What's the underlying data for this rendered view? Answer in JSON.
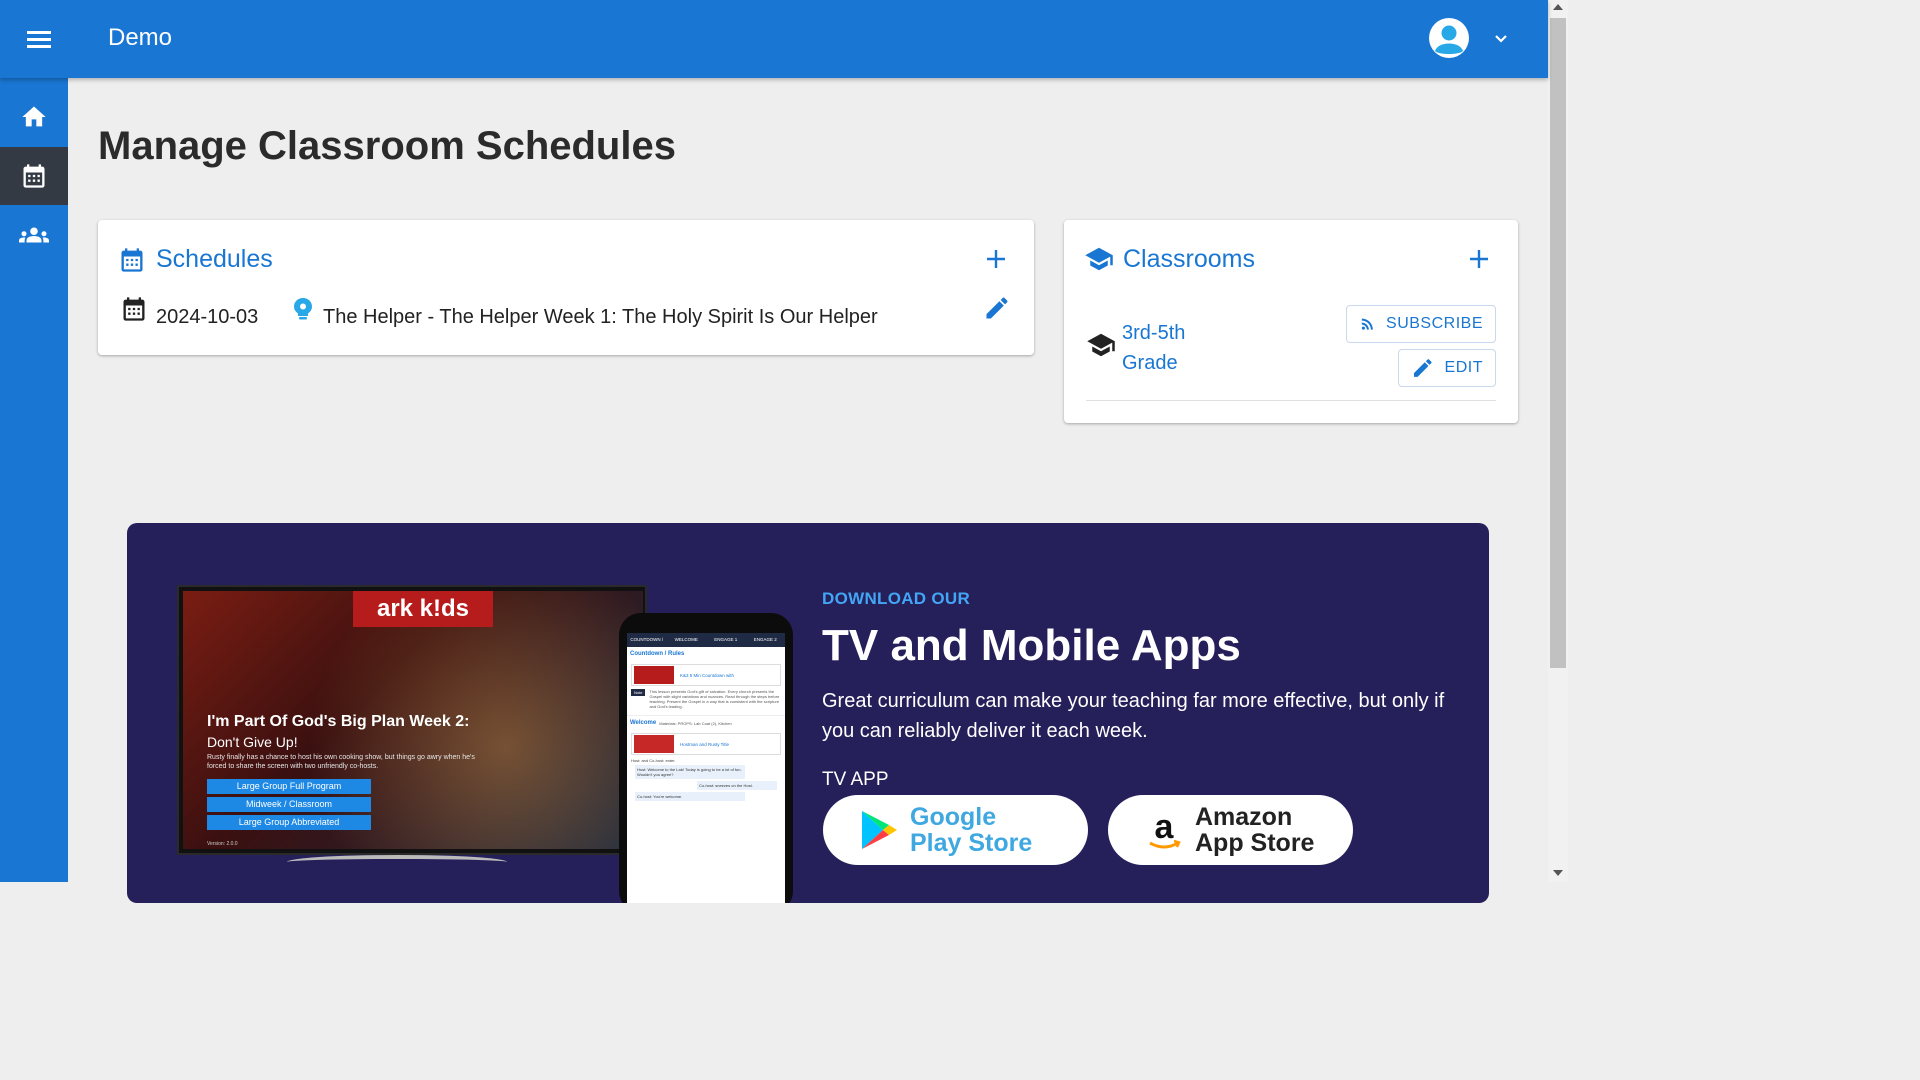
{
  "app": {
    "title": "Demo"
  },
  "page": {
    "title": "Manage Classroom Schedules"
  },
  "schedules": {
    "title": "Schedules",
    "items": [
      {
        "date": "2024-10-03",
        "name": "The Helper - The Helper Week 1: The Holy Spirit Is Our Helper"
      }
    ]
  },
  "classrooms": {
    "title": "Classrooms",
    "items": [
      {
        "name": "3rd-5th Grade",
        "subscribe_label": "SUBSCRIBE",
        "edit_label": "EDIT"
      }
    ]
  },
  "promo": {
    "overline": "DOWNLOAD OUR",
    "title": "TV and Mobile Apps",
    "description": "Great curriculum can make your teaching far more effective, but only if you can reliably deliver it each week.",
    "tv_app_label": "TV APP",
    "google_store": {
      "line1": "Google",
      "line2": "Play Store"
    },
    "amazon_store": {
      "line1": "Amazon",
      "line2": "App Store"
    },
    "tv_screen": {
      "logo": "ark k!ds",
      "title": "I'm Part Of God's Big Plan Week 2:",
      "subtitle": "Don't Give Up!",
      "description": "Rusty finally has a chance to host his own cooking show, but things go awry when he's forced to share the screen with two unfriendly co-hosts.",
      "buttons": [
        "Large Group Full Program",
        "Midweek / Classroom",
        "Large Group Abbreviated"
      ],
      "version": "Version: 2.0.0"
    },
    "phone_screen": {
      "tabs": [
        "COUNTDOWN / RULES",
        "WELCOME",
        "ENGAGE 1",
        "ENGAGE 2"
      ],
      "section1": "Countdown / Rules",
      "row1": "K&3 5 Min Countdown with",
      "note_label": "Note",
      "note": "This lesson presents God's gift of salvation. Every church presents the Gospel with slight variations and nuances. Read through the steps before teaching. Present the Gospel in a way that is consistent with the scripture and God's leading.",
      "section2": "Welcome",
      "materials": "Materials: PROPS: Lab Coat (2), Kitchen",
      "row2": "Hostman and Rusty Title",
      "enter": "Host: and Co-host: enter.",
      "bubble1": "Host: Welcome to the Lab! Today is going to be a lot of fun. Wouldn't you agree?",
      "bubble2": "Co-host: sneezes on the Host.",
      "bubble3": "Co-host: You're welcome."
    }
  },
  "colors": {
    "primary": "#1976d2",
    "promo_bg": "#251f5a",
    "accent": "#42a5f5"
  }
}
